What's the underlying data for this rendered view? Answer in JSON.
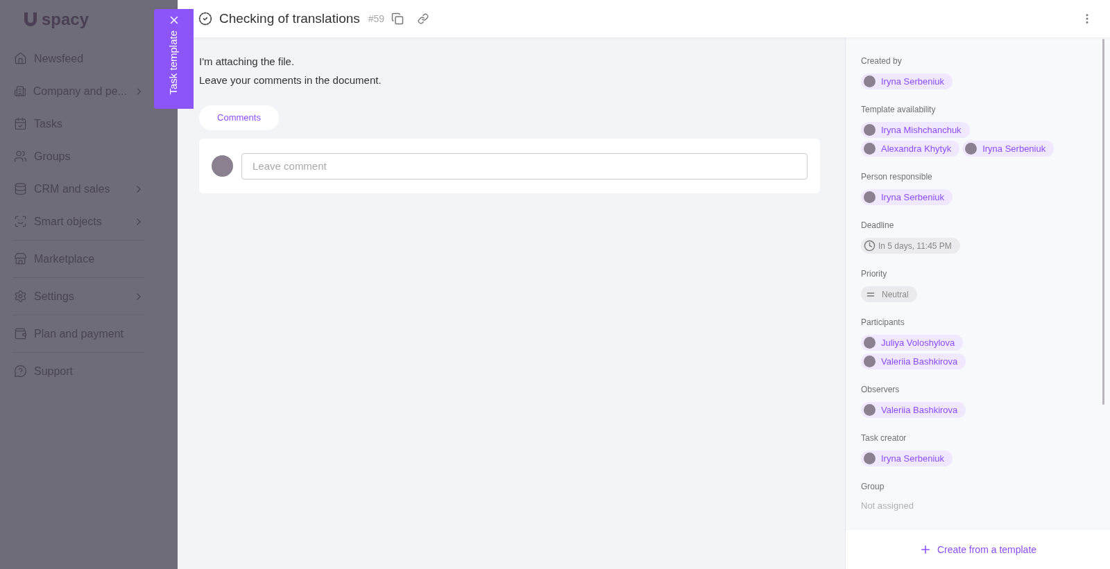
{
  "sidebar": {
    "logo": "spacy",
    "sections": [
      {
        "items": [
          {
            "label": "Newsfeed",
            "has_submenu": false
          },
          {
            "label": "Company and pe...",
            "has_submenu": true
          },
          {
            "label": "Tasks",
            "has_submenu": false
          },
          {
            "label": "Groups",
            "has_submenu": false
          },
          {
            "label": "CRM and sales",
            "has_submenu": true
          },
          {
            "label": "Smart objects",
            "has_submenu": true
          }
        ]
      },
      {
        "items": [
          {
            "label": "Marketplace",
            "has_submenu": false
          }
        ]
      },
      {
        "items": [
          {
            "label": "Settings",
            "has_submenu": true
          }
        ]
      },
      {
        "items": [
          {
            "label": "Plan and payment",
            "has_submenu": false
          }
        ]
      },
      {
        "items": [
          {
            "label": "Support",
            "has_submenu": false
          }
        ]
      }
    ]
  },
  "side_tab": {
    "label": "Task template"
  },
  "header": {
    "title": "Checking of translations",
    "number": "#59"
  },
  "description": [
    "I'm attaching the file.",
    "Leave your comments in the document."
  ],
  "comments_tab": {
    "label": "Comments",
    "selected": true
  },
  "comment_field": {
    "placeholder": "Leave comment"
  },
  "details": [
    {
      "kind": "people",
      "label": "Created by",
      "people": [
        "Iryna Serbeniuk"
      ]
    },
    {
      "kind": "people",
      "label": "Template availability",
      "people": [
        "Iryna Mishchanchuk",
        "Alexandra Khytyk",
        "Iryna Serbeniuk"
      ]
    },
    {
      "kind": "people",
      "label": "Person responsible",
      "people": [
        "Iryna Serbeniuk"
      ]
    },
    {
      "kind": "deadline",
      "label": "Deadline",
      "value": "In 5 days, 11:45 PM"
    },
    {
      "kind": "priority",
      "label": "Priority",
      "value": "Neutral"
    },
    {
      "kind": "people",
      "label": "Participants",
      "people": [
        "Juliya Voloshylova",
        "Valeriia Bashkirova"
      ]
    },
    {
      "kind": "people",
      "label": "Observers",
      "people": [
        "Valeriia Bashkirova"
      ]
    },
    {
      "kind": "people",
      "label": "Task creator",
      "people": [
        "Iryna Serbeniuk"
      ]
    },
    {
      "kind": "text",
      "label": "Group",
      "value": "Not assigned"
    }
  ],
  "create_button": {
    "label": "Create from a template"
  }
}
